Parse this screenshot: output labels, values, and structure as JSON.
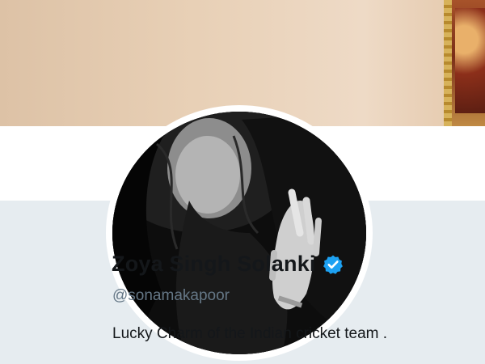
{
  "profile": {
    "display_name": "Zoya Singh Solanki",
    "handle": "@sonamakapoor",
    "bio": "Lucky Charm of the Indian cricket team .",
    "verified": true,
    "verified_badge_icon": "verified-badge-icon"
  },
  "colors": {
    "page_background": "#e6ecf0",
    "name_text": "#14171a",
    "handle_text": "#657786",
    "verified_blue": "#1da1f2"
  }
}
